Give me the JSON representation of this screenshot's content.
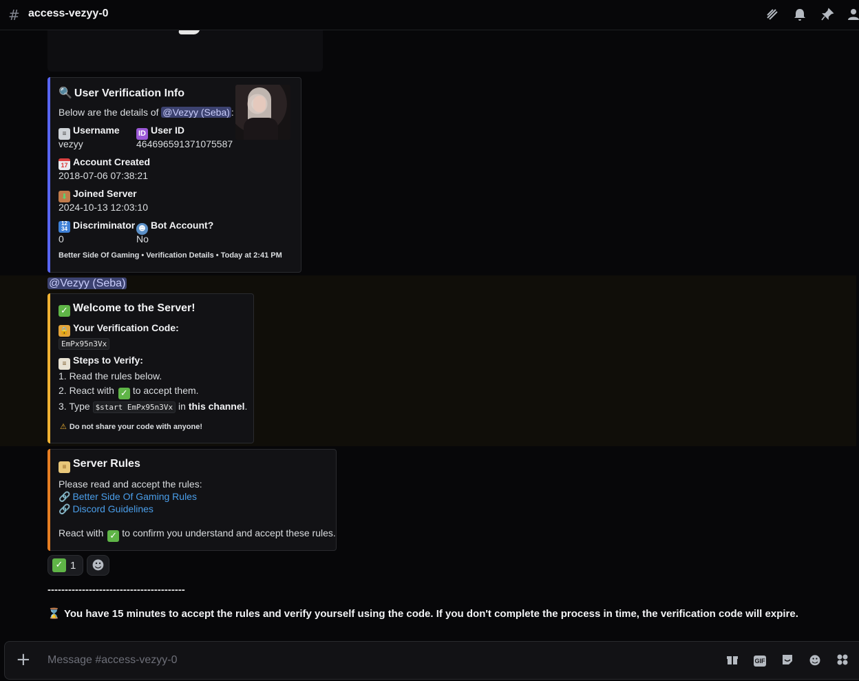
{
  "header": {
    "channel_name": "access-vezyy-0",
    "icons": [
      "threads-icon",
      "bell-icon",
      "pin-icon",
      "members-icon"
    ]
  },
  "verification_info": {
    "title": "User Verification Info",
    "intro_prefix": "Below are the details of",
    "mention": "@Vezyy (Seba)",
    "intro_suffix": ":",
    "username_label": "Username",
    "username_value": "vezyy",
    "userid_badge": "ID",
    "userid_label": "User ID",
    "userid_value": "464696591371075587",
    "created_label": "Account Created",
    "created_value": "2018-07-06 07:38:21",
    "joined_label": "Joined Server",
    "joined_value": "2024-10-13 12:03:10",
    "disc_label": "Discriminator",
    "disc_value": "0",
    "bot_label": "Bot Account?",
    "bot_value": "No",
    "footer": "Better Side Of Gaming • Verification Details • Today at 2:41 PM",
    "accent": "#5865f2"
  },
  "mention_line": "@Vezyy (Seba)",
  "welcome": {
    "title": "Welcome to the Server!",
    "code_label": "Your Verification Code:",
    "code_value": "EmPx95n3Vx",
    "steps_label": "Steps to Verify:",
    "step1": "1. Read the rules below.",
    "step2_prefix": "2. React with",
    "step2_suffix": "to accept them.",
    "step3_prefix": "3. Type",
    "step3_code": "$start EmPx95n3Vx",
    "step3_mid": "in",
    "step3_bold": "this channel",
    "step3_end": ".",
    "footer": "Do not share your code with anyone!",
    "accent": "#f0b232"
  },
  "rules": {
    "title": "Server Rules",
    "intro": "Please read and accept the rules:",
    "link1": "Better Side Of Gaming Rules",
    "link2": "Discord Guidelines",
    "confirm_prefix": "React with",
    "confirm_suffix": "to confirm you understand and accept these rules.",
    "accent": "#e67e22"
  },
  "reaction": {
    "count": "1"
  },
  "dashes": "----------------------------------------",
  "warning": "You have 15 minutes to accept the rules and verify yourself using the code. If you don't complete the process in time, the verification code will expire.",
  "composer": {
    "placeholder": "Message #access-vezyy-0"
  }
}
